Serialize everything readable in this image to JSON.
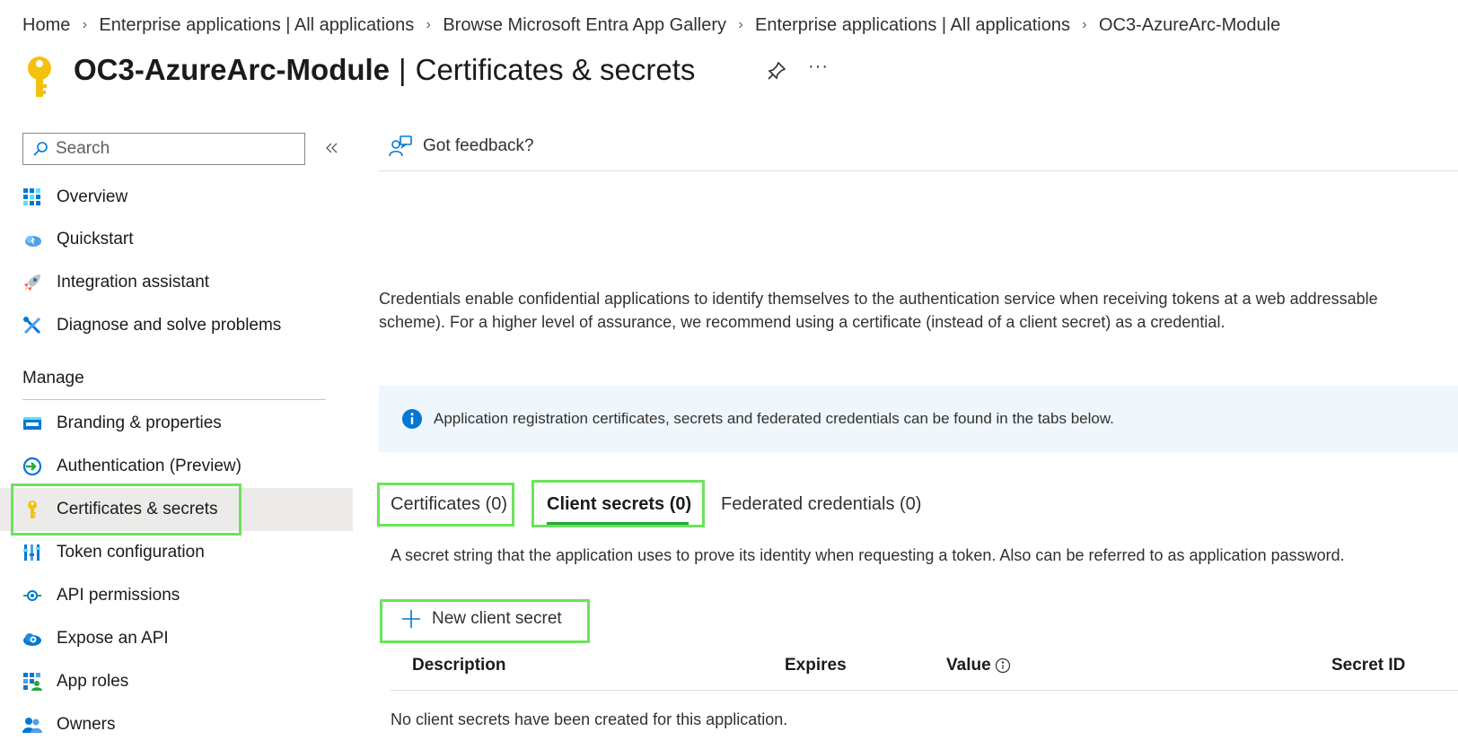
{
  "breadcrumb": [
    {
      "label": "Home"
    },
    {
      "label": "Enterprise applications | All applications"
    },
    {
      "label": "Browse Microsoft Entra App Gallery"
    },
    {
      "label": "Enterprise applications | All applications"
    },
    {
      "label": "OC3-AzureArc-Module"
    }
  ],
  "header": {
    "app_name": "OC3-AzureArc-Module",
    "separator": "|",
    "blade_name": "Certificates & secrets",
    "more_label": "···",
    "icon": "key-icon"
  },
  "sidebar": {
    "search_placeholder": "Search",
    "items": [
      {
        "label": "Overview",
        "icon": "overview-grid-icon"
      },
      {
        "label": "Quickstart",
        "icon": "quickstart-cloud-icon"
      },
      {
        "label": "Integration assistant",
        "icon": "rocket-icon"
      },
      {
        "label": "Diagnose and solve problems",
        "icon": "wrench-icon"
      }
    ],
    "manage_header": "Manage",
    "manage_items": [
      {
        "label": "Branding & properties",
        "icon": "branding-icon"
      },
      {
        "label": "Authentication (Preview)",
        "icon": "authentication-icon"
      },
      {
        "label": "Certificates & secrets",
        "icon": "key-icon",
        "active": true
      },
      {
        "label": "Token configuration",
        "icon": "token-bars-icon"
      },
      {
        "label": "API permissions",
        "icon": "api-permissions-icon"
      },
      {
        "label": "Expose an API",
        "icon": "cloud-gear-icon"
      },
      {
        "label": "App roles",
        "icon": "app-roles-icon"
      },
      {
        "label": "Owners",
        "icon": "owners-icon"
      }
    ]
  },
  "main": {
    "feedback_label": "Got feedback?",
    "description_line1": "Credentials enable confidential applications to identify themselves to the authentication service when receiving tokens at a web addressable",
    "description_line2": "scheme). For a higher level of assurance, we recommend using a certificate (instead of a client secret) as a credential.",
    "info_banner": "Application registration certificates, secrets and federated credentials can be found in the tabs below.",
    "tabs": [
      {
        "label": "Certificates (0)"
      },
      {
        "label": "Client secrets (0)",
        "active": true
      },
      {
        "label": "Federated credentials (0)"
      }
    ],
    "tab_description": "A secret string that the application uses to prove its identity when requesting a token. Also can be referred to as application password.",
    "new_secret_label": "New client secret",
    "table": {
      "columns": [
        "Description",
        "Expires",
        "Value",
        "Secret ID"
      ],
      "empty_message": "No client secrets have been created for this application."
    }
  },
  "colors": {
    "accent": "#0078d4",
    "highlight": "#6ce35b",
    "active_tab_underline": "#20a93b",
    "key_yellow": "#f4c20d"
  }
}
